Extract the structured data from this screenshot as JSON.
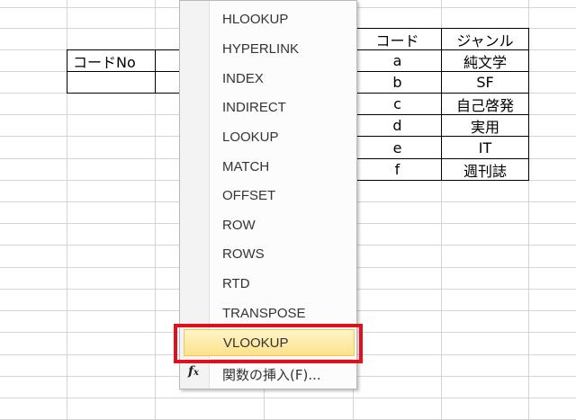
{
  "sheet": {
    "left_table": {
      "header": "コードNo"
    },
    "right_table": {
      "headers": [
        "コード",
        "ジャンル"
      ],
      "rows": [
        [
          "a",
          "純文学"
        ],
        [
          "b",
          "SF"
        ],
        [
          "c",
          "自己啓発"
        ],
        [
          "d",
          "実用"
        ],
        [
          "e",
          "IT"
        ],
        [
          "f",
          "週刊誌"
        ]
      ]
    }
  },
  "menu": {
    "items": [
      "HLOOKUP",
      "HYPERLINK",
      "INDEX",
      "INDIRECT",
      "LOOKUP",
      "MATCH",
      "OFFSET",
      "ROW",
      "ROWS",
      "RTD",
      "TRANSPOSE",
      "VLOOKUP"
    ],
    "highlighted": "VLOOKUP",
    "insert_function_label": "関数の挿入(F)...",
    "insert_function_icon": "fx-icon"
  },
  "colors": {
    "highlight_border": "#e0101c",
    "menu_highlight": "#fde28b"
  }
}
